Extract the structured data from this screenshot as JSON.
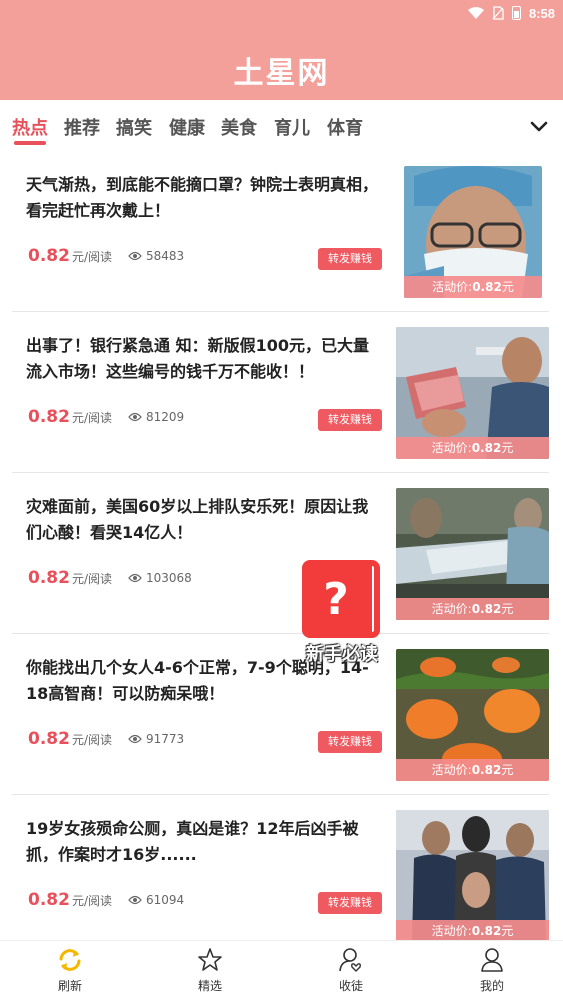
{
  "status_bar": {
    "time": "8:58"
  },
  "app": {
    "title": "土星网"
  },
  "tabs": [
    {
      "label": "热点"
    },
    {
      "label": "推荐"
    },
    {
      "label": "搞笑"
    },
    {
      "label": "健康"
    },
    {
      "label": "美食"
    },
    {
      "label": "育儿"
    },
    {
      "label": "体育"
    }
  ],
  "articles": [
    {
      "title": "天气渐热，到底能不能摘口罩？钟院士表明真相，看完赶忙再次戴上！",
      "price": "0.82",
      "unit": "元/阅读",
      "views": "58483",
      "share_label": "转发赚钱",
      "promo_prefix": "活动价:",
      "promo_value": "0.82",
      "promo_suffix": "元"
    },
    {
      "title": "出事了！银行紧急通 知：新版假100元，已大量流入市场！这些编号的钱千万不能收！！",
      "price": "0.82",
      "unit": "元/阅读",
      "views": "81209",
      "share_label": "转发赚钱",
      "promo_prefix": "活动价:",
      "promo_value": "0.82",
      "promo_suffix": "元"
    },
    {
      "title": "灾难面前，美国60岁以上排队安乐死！原因让我们心酸！看哭14亿人！",
      "price": "0.82",
      "unit": "元/阅读",
      "views": "103068",
      "share_label": "",
      "promo_prefix": "活动价:",
      "promo_value": "0.82",
      "promo_suffix": "元"
    },
    {
      "title": "你能找出几个女人4-6个正常，7-9个聪明，14-18高智商！可以防痴呆哦！",
      "price": "0.82",
      "unit": "元/阅读",
      "views": "91773",
      "share_label": "转发赚钱",
      "promo_prefix": "活动价:",
      "promo_value": "0.82",
      "promo_suffix": "元"
    },
    {
      "title": "19岁女孩殒命公厕，真凶是谁？12年后凶手被抓，作案时才16岁......",
      "price": "0.82",
      "unit": "元/阅读",
      "views": "61094",
      "share_label": "转发赚钱",
      "promo_prefix": "活动价:",
      "promo_value": "0.82",
      "promo_suffix": "元"
    }
  ],
  "float_guide": {
    "symbol": "?",
    "label": "新手必读"
  },
  "bottom_nav": [
    {
      "label": "刷新",
      "icon": "refresh-icon"
    },
    {
      "label": "精选",
      "icon": "star-icon"
    },
    {
      "label": "收徒",
      "icon": "recruit-icon"
    },
    {
      "label": "我的",
      "icon": "profile-icon"
    }
  ],
  "colors": {
    "header": "#f4a09a",
    "accent": "#e8505b",
    "float": "#f23b3b",
    "refresh_active": "#f5b800"
  }
}
